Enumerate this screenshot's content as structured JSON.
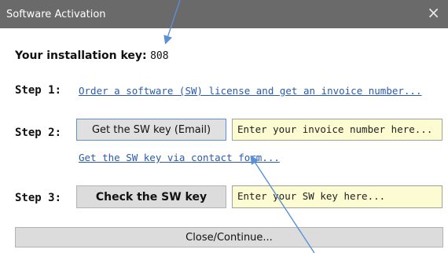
{
  "window": {
    "title": "Software Activation",
    "close_glyph": "×"
  },
  "installation": {
    "label": "Your installation key:",
    "value": "808"
  },
  "step1": {
    "label": "Step 1:",
    "link": "Order a software (SW) license and get an invoice number..."
  },
  "step2": {
    "label": "Step 2:",
    "button": "Get the SW key (Email)",
    "input_value": "Enter your invoice number here...",
    "contact_link": "Get the SW key via contact form..."
  },
  "step3": {
    "label": "Step 3:",
    "button": "Check the SW key",
    "input_value": "Enter your SW key here..."
  },
  "footer": {
    "button": "Close/Continue..."
  },
  "colors": {
    "titlebar": "#6a6a6a",
    "link": "#2a5bab",
    "field_bg": "#fcfbd2",
    "arrow": "#5b8fd8"
  }
}
